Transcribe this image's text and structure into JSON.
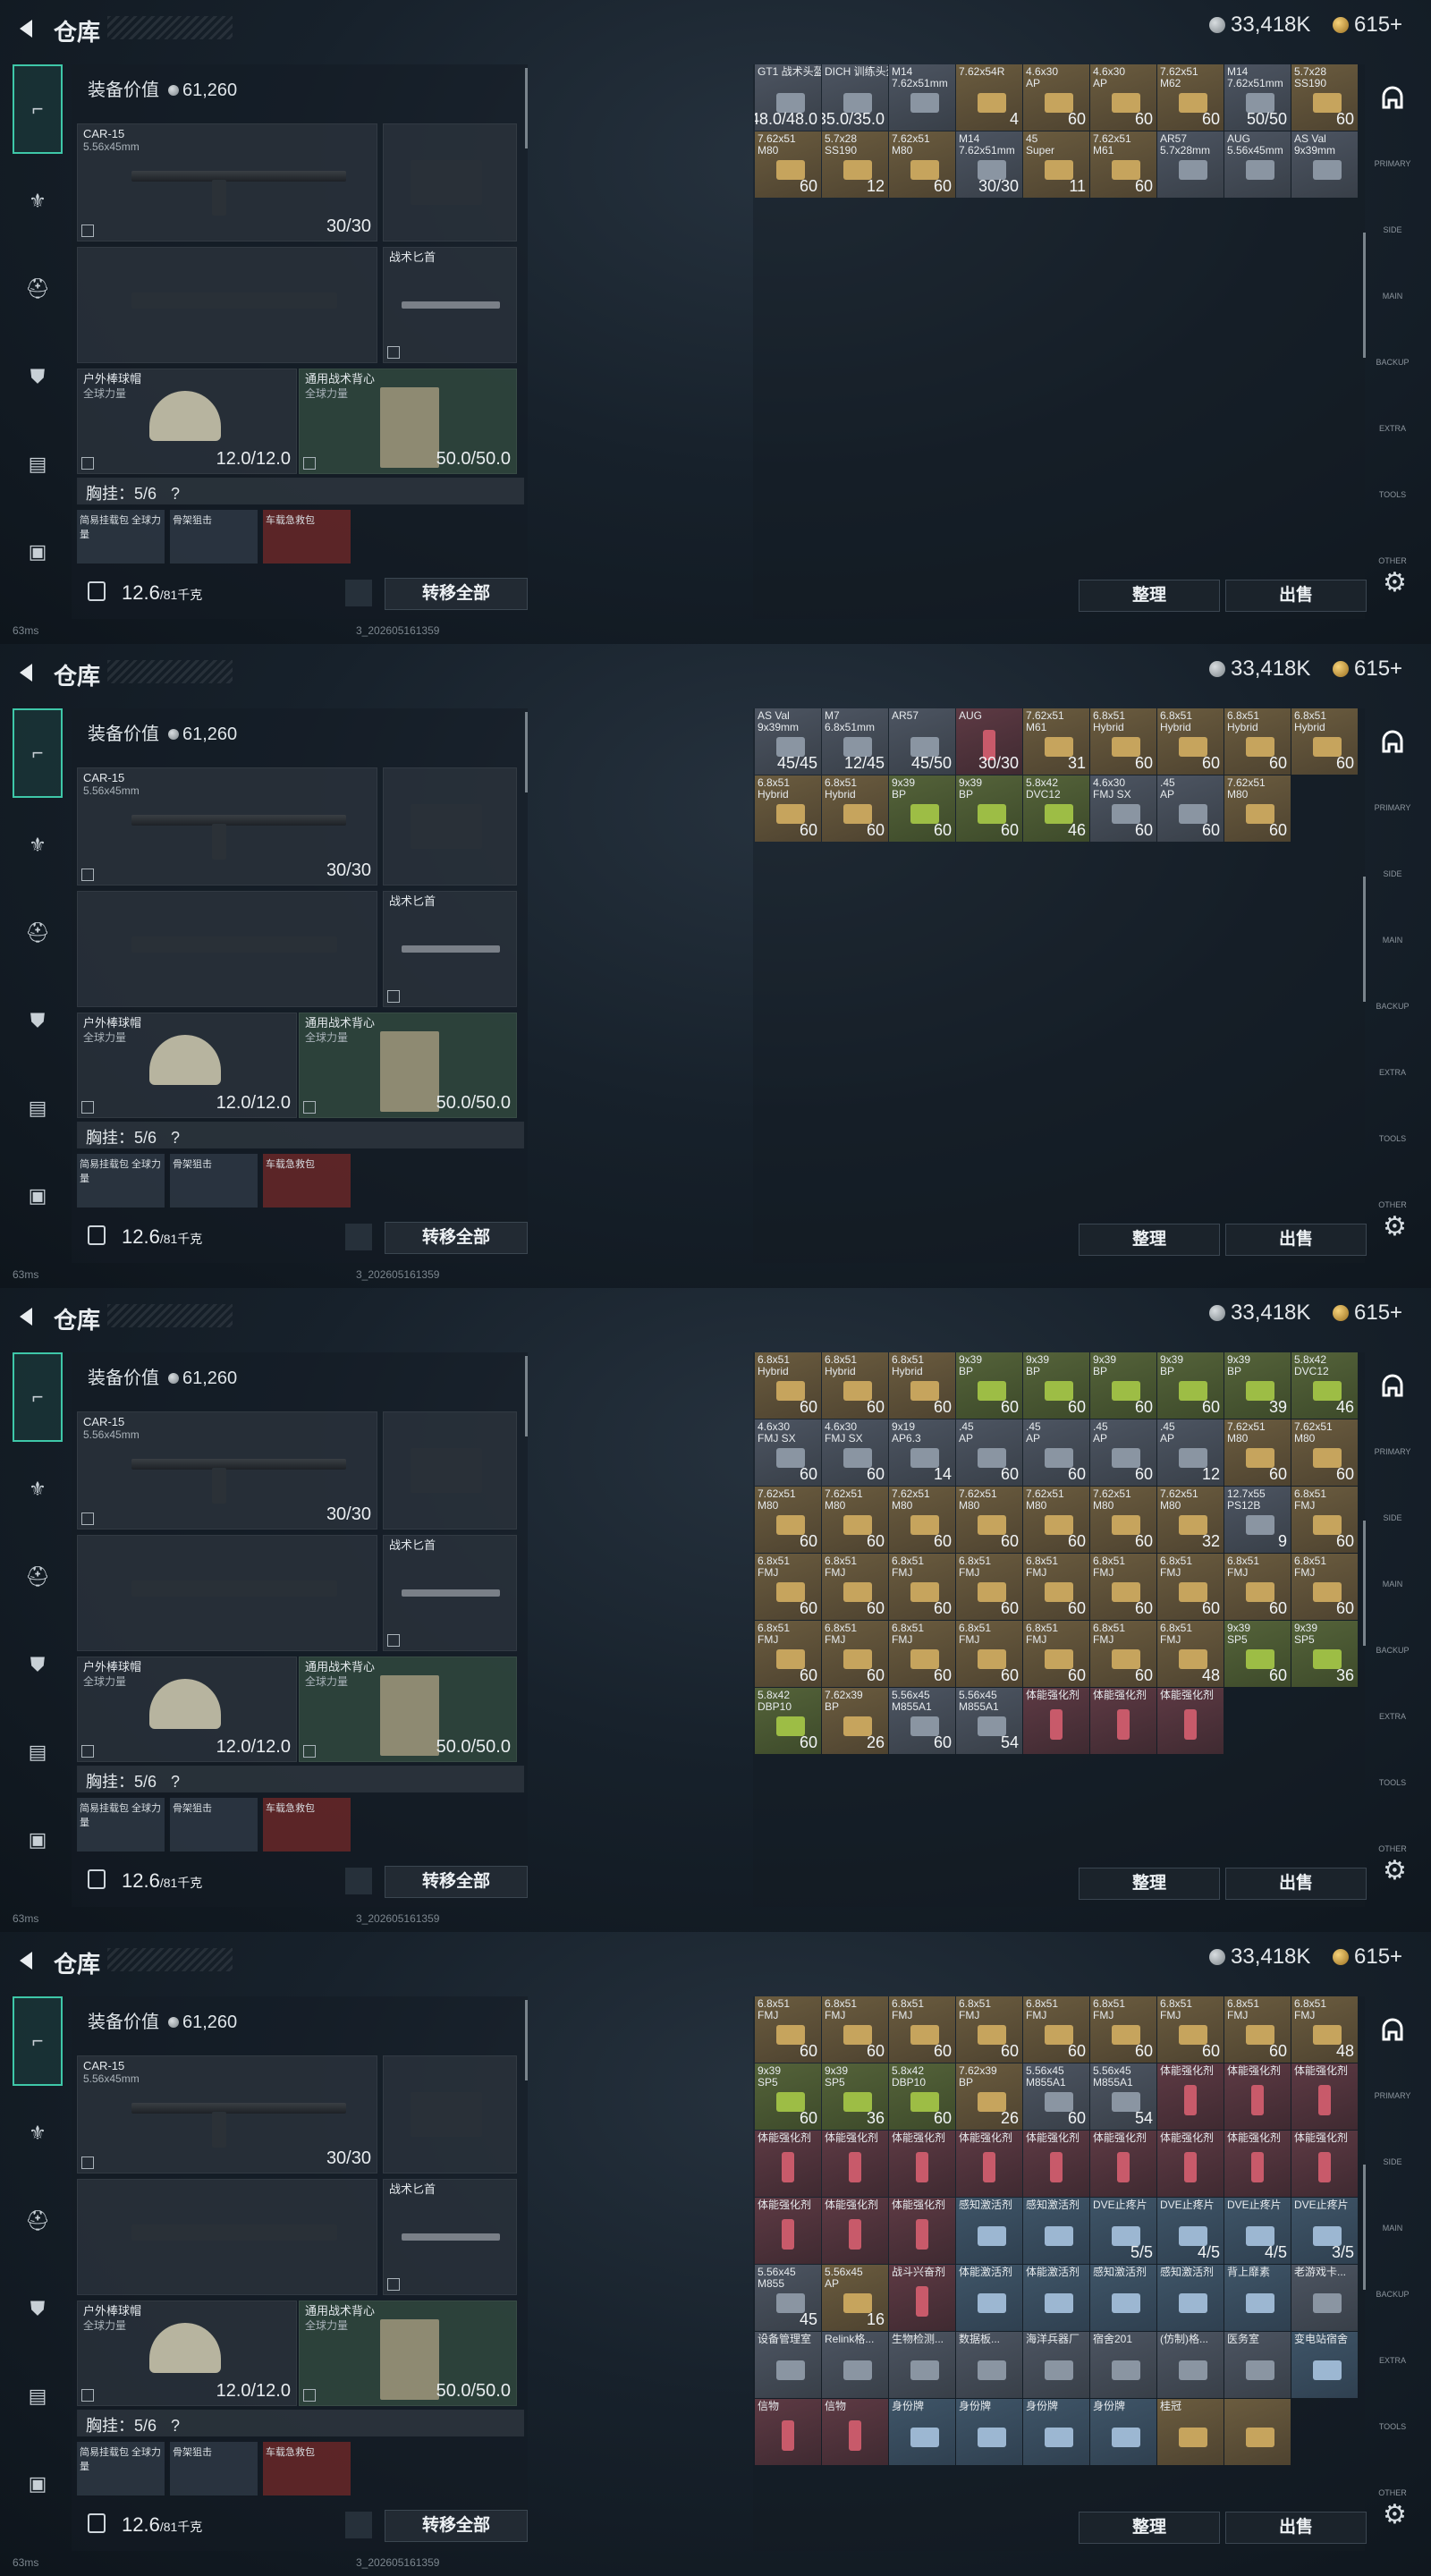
{
  "header": {
    "title": "仓库",
    "silver": "33,418K",
    "gold": "615+"
  },
  "loadout": {
    "value_label": "装备价值",
    "value": "61,260",
    "primary": {
      "name": "CAR-15",
      "caliber": "5.56x45mm",
      "count": "30/30"
    },
    "knife": {
      "name": "战术匕首"
    },
    "helmet": {
      "name": "户外棒球帽",
      "sub": "全球力量",
      "count": "12.0/12.0"
    },
    "armor": {
      "name": "通用战术背心",
      "sub": "全球力量",
      "count": "50.0/50.0"
    },
    "chest_label": "胸挂：5/6",
    "chest_help": "?",
    "mini_items": [
      "简易挂载包\n全球力量",
      "骨架狙击",
      "车载急救包"
    ],
    "weight": "12.6",
    "weight_max": "/81千克",
    "transfer_button": "转移全部"
  },
  "storage": {
    "sort_button": "整理",
    "sell_button": "出售"
  },
  "status": {
    "ping": "63ms",
    "build": "3_202605161359"
  },
  "frames": [
    {
      "cells": [
        {
          "n": "GT1 战术头盔",
          "q": "48.0/48.0",
          "c": "grey"
        },
        {
          "n": "DICH 训练头盔",
          "q": "35.0/35.0",
          "c": "grey"
        },
        {
          "n": "M14\n7.62x51mm",
          "q": "",
          "c": "grey"
        },
        {
          "n": "7.62x54R",
          "q": "4",
          "c": "tan"
        },
        {
          "n": "4.6x30\nAP",
          "q": "60",
          "c": "tan"
        },
        {
          "n": "4.6x30\nAP",
          "q": "60",
          "c": "tan"
        },
        {
          "n": "7.62x51\nM62",
          "q": "60",
          "c": "tan"
        },
        {
          "n": "M14\n7.62x51mm",
          "q": "50/50",
          "c": "grey"
        },
        {
          "n": "5.7x28\nSS190",
          "q": "60",
          "c": "tan"
        },
        {
          "n": "7.62x51\nM80",
          "q": "60",
          "c": "tan"
        },
        {
          "n": "5.7x28\nSS190",
          "q": "12",
          "c": "tan"
        },
        {
          "n": "7.62x51\nM80",
          "q": "60",
          "c": "tan"
        },
        {
          "n": "M14\n7.62x51mm",
          "q": "30/30",
          "c": "grey"
        },
        {
          "n": "45\nSuper",
          "q": "11",
          "c": "tan"
        },
        {
          "n": "7.62x51\nM61",
          "q": "60",
          "c": "tan"
        },
        {
          "n": "AR57\n5.7x28mm",
          "q": "",
          "c": "grey"
        },
        {
          "n": "AUG\n5.56x45mm",
          "q": "",
          "c": "grey"
        },
        {
          "n": "AS Val\n9x39mm",
          "q": "",
          "c": "grey"
        }
      ]
    },
    {
      "cells": [
        {
          "n": "AS Val\n9x39mm",
          "q": "45/45",
          "c": "grey"
        },
        {
          "n": "M7\n6.8x51mm",
          "q": "12/45",
          "c": "grey"
        },
        {
          "n": "AR57",
          "q": "45/50",
          "c": "grey"
        },
        {
          "n": "AUG",
          "q": "30/30",
          "c": "red"
        },
        {
          "n": "7.62x51\nM61",
          "q": "31",
          "c": "tan"
        },
        {
          "n": "6.8x51\nHybrid",
          "q": "60",
          "c": "tan"
        },
        {
          "n": "6.8x51\nHybrid",
          "q": "60",
          "c": "tan"
        },
        {
          "n": "6.8x51\nHybrid",
          "q": "60",
          "c": "tan"
        },
        {
          "n": "6.8x51\nHybrid",
          "q": "60",
          "c": "tan"
        },
        {
          "n": "6.8x51\nHybrid",
          "q": "60",
          "c": "tan"
        },
        {
          "n": "6.8x51\nHybrid",
          "q": "60",
          "c": "tan"
        },
        {
          "n": "9x39\nBP",
          "q": "60",
          "c": "green"
        },
        {
          "n": "9x39\nBP",
          "q": "60",
          "c": "green"
        },
        {
          "n": "5.8x42\nDVC12",
          "q": "46",
          "c": "green"
        },
        {
          "n": "4.6x30\nFMJ SX",
          "q": "60",
          "c": "grey"
        },
        {
          "n": ".45\nAP",
          "q": "60",
          "c": "grey"
        },
        {
          "n": "7.62x51\nM80",
          "q": "60",
          "c": "tan"
        }
      ]
    },
    {
      "cells": [
        {
          "n": "6.8x51\nHybrid",
          "q": "60",
          "c": "tan"
        },
        {
          "n": "6.8x51\nHybrid",
          "q": "60",
          "c": "tan"
        },
        {
          "n": "6.8x51\nHybrid",
          "q": "60",
          "c": "tan"
        },
        {
          "n": "9x39\nBP",
          "q": "60",
          "c": "green"
        },
        {
          "n": "9x39\nBP",
          "q": "60",
          "c": "green"
        },
        {
          "n": "9x39\nBP",
          "q": "60",
          "c": "green"
        },
        {
          "n": "9x39\nBP",
          "q": "60",
          "c": "green"
        },
        {
          "n": "9x39\nBP",
          "q": "39",
          "c": "green"
        },
        {
          "n": "5.8x42\nDVC12",
          "q": "46",
          "c": "green"
        },
        {
          "n": "4.6x30\nFMJ SX",
          "q": "60",
          "c": "grey"
        },
        {
          "n": "4.6x30\nFMJ SX",
          "q": "60",
          "c": "grey"
        },
        {
          "n": "9x19\nAP6.3",
          "q": "14",
          "c": "grey"
        },
        {
          "n": ".45\nAP",
          "q": "60",
          "c": "grey"
        },
        {
          "n": ".45\nAP",
          "q": "60",
          "c": "grey"
        },
        {
          "n": ".45\nAP",
          "q": "60",
          "c": "grey"
        },
        {
          "n": ".45\nAP",
          "q": "12",
          "c": "grey"
        },
        {
          "n": "7.62x51\nM80",
          "q": "60",
          "c": "tan"
        },
        {
          "n": "7.62x51\nM80",
          "q": "60",
          "c": "tan"
        },
        {
          "n": "7.62x51\nM80",
          "q": "60",
          "c": "tan"
        },
        {
          "n": "7.62x51\nM80",
          "q": "60",
          "c": "tan"
        },
        {
          "n": "7.62x51\nM80",
          "q": "60",
          "c": "tan"
        },
        {
          "n": "7.62x51\nM80",
          "q": "60",
          "c": "tan"
        },
        {
          "n": "7.62x51\nM80",
          "q": "60",
          "c": "tan"
        },
        {
          "n": "7.62x51\nM80",
          "q": "60",
          "c": "tan"
        },
        {
          "n": "7.62x51\nM80",
          "q": "32",
          "c": "tan"
        },
        {
          "n": "12.7x55\nPS12B",
          "q": "9",
          "c": "grey"
        },
        {
          "n": "6.8x51\nFMJ",
          "q": "60",
          "c": "tan"
        },
        {
          "n": "6.8x51\nFMJ",
          "q": "60",
          "c": "tan"
        },
        {
          "n": "6.8x51\nFMJ",
          "q": "60",
          "c": "tan"
        },
        {
          "n": "6.8x51\nFMJ",
          "q": "60",
          "c": "tan"
        },
        {
          "n": "6.8x51\nFMJ",
          "q": "60",
          "c": "tan"
        },
        {
          "n": "6.8x51\nFMJ",
          "q": "60",
          "c": "tan"
        },
        {
          "n": "6.8x51\nFMJ",
          "q": "60",
          "c": "tan"
        },
        {
          "n": "6.8x51\nFMJ",
          "q": "60",
          "c": "tan"
        },
        {
          "n": "6.8x51\nFMJ",
          "q": "60",
          "c": "tan"
        },
        {
          "n": "6.8x51\nFMJ",
          "q": "60",
          "c": "tan"
        },
        {
          "n": "6.8x51\nFMJ",
          "q": "60",
          "c": "tan"
        },
        {
          "n": "6.8x51\nFMJ",
          "q": "60",
          "c": "tan"
        },
        {
          "n": "6.8x51\nFMJ",
          "q": "60",
          "c": "tan"
        },
        {
          "n": "6.8x51\nFMJ",
          "q": "60",
          "c": "tan"
        },
        {
          "n": "6.8x51\nFMJ",
          "q": "60",
          "c": "tan"
        },
        {
          "n": "6.8x51\nFMJ",
          "q": "60",
          "c": "tan"
        },
        {
          "n": "6.8x51\nFMJ",
          "q": "48",
          "c": "tan"
        },
        {
          "n": "9x39\nSP5",
          "q": "60",
          "c": "green"
        },
        {
          "n": "9x39\nSP5",
          "q": "36",
          "c": "green"
        },
        {
          "n": "5.8x42\nDBP10",
          "q": "60",
          "c": "green"
        },
        {
          "n": "7.62x39\nBP",
          "q": "26",
          "c": "tan"
        },
        {
          "n": "5.56x45\nM855A1",
          "q": "60",
          "c": "grey"
        },
        {
          "n": "5.56x45\nM855A1",
          "q": "54",
          "c": "grey"
        },
        {
          "n": "体能强化剂",
          "q": "",
          "c": "red"
        },
        {
          "n": "体能强化剂",
          "q": "",
          "c": "red"
        },
        {
          "n": "体能强化剂",
          "q": "",
          "c": "red"
        }
      ]
    },
    {
      "cells": [
        {
          "n": "6.8x51\nFMJ",
          "q": "60",
          "c": "tan"
        },
        {
          "n": "6.8x51\nFMJ",
          "q": "60",
          "c": "tan"
        },
        {
          "n": "6.8x51\nFMJ",
          "q": "60",
          "c": "tan"
        },
        {
          "n": "6.8x51\nFMJ",
          "q": "60",
          "c": "tan"
        },
        {
          "n": "6.8x51\nFMJ",
          "q": "60",
          "c": "tan"
        },
        {
          "n": "6.8x51\nFMJ",
          "q": "60",
          "c": "tan"
        },
        {
          "n": "6.8x51\nFMJ",
          "q": "60",
          "c": "tan"
        },
        {
          "n": "6.8x51\nFMJ",
          "q": "60",
          "c": "tan"
        },
        {
          "n": "6.8x51\nFMJ",
          "q": "48",
          "c": "tan"
        },
        {
          "n": "9x39\nSP5",
          "q": "60",
          "c": "green"
        },
        {
          "n": "9x39\nSP5",
          "q": "36",
          "c": "green"
        },
        {
          "n": "5.8x42\nDBP10",
          "q": "60",
          "c": "green"
        },
        {
          "n": "7.62x39\nBP",
          "q": "26",
          "c": "tan"
        },
        {
          "n": "5.56x45\nM855A1",
          "q": "60",
          "c": "grey"
        },
        {
          "n": "5.56x45\nM855A1",
          "q": "54",
          "c": "grey"
        },
        {
          "n": "体能强化剂",
          "q": "",
          "c": "red"
        },
        {
          "n": "体能强化剂",
          "q": "",
          "c": "red"
        },
        {
          "n": "体能强化剂",
          "q": "",
          "c": "red"
        },
        {
          "n": "体能强化剂",
          "q": "",
          "c": "red"
        },
        {
          "n": "体能强化剂",
          "q": "",
          "c": "red"
        },
        {
          "n": "体能强化剂",
          "q": "",
          "c": "red"
        },
        {
          "n": "体能强化剂",
          "q": "",
          "c": "red"
        },
        {
          "n": "体能强化剂",
          "q": "",
          "c": "red"
        },
        {
          "n": "体能强化剂",
          "q": "",
          "c": "red"
        },
        {
          "n": "体能强化剂",
          "q": "",
          "c": "red"
        },
        {
          "n": "体能强化剂",
          "q": "",
          "c": "red"
        },
        {
          "n": "体能强化剂",
          "q": "",
          "c": "red"
        },
        {
          "n": "体能强化剂",
          "q": "",
          "c": "red"
        },
        {
          "n": "体能强化剂",
          "q": "",
          "c": "red"
        },
        {
          "n": "体能强化剂",
          "q": "",
          "c": "red"
        },
        {
          "n": "感知激活剂",
          "q": "",
          "c": "blue"
        },
        {
          "n": "感知激活剂",
          "q": "",
          "c": "blue"
        },
        {
          "n": "DVE止疼片",
          "q": "5/5",
          "c": "blue"
        },
        {
          "n": "DVE止疼片",
          "q": "4/5",
          "c": "blue"
        },
        {
          "n": "DVE止疼片",
          "q": "4/5",
          "c": "blue"
        },
        {
          "n": "DVE止疼片",
          "q": "3/5",
          "c": "blue"
        },
        {
          "n": "5.56x45\nM855",
          "q": "45",
          "c": "grey"
        },
        {
          "n": "5.56x45\nAP",
          "q": "16",
          "c": "tan"
        },
        {
          "n": "战斗兴奋剂",
          "q": "",
          "c": "red"
        },
        {
          "n": "体能激活剂",
          "q": "",
          "c": "blue"
        },
        {
          "n": "体能激活剂",
          "q": "",
          "c": "blue"
        },
        {
          "n": "感知激活剂",
          "q": "",
          "c": "blue"
        },
        {
          "n": "感知激活剂",
          "q": "",
          "c": "blue"
        },
        {
          "n": "背上靡素",
          "q": "",
          "c": "blue"
        },
        {
          "n": "老游戏卡...",
          "q": "",
          "c": "grey"
        },
        {
          "n": "设备管理室",
          "q": "",
          "c": "grey"
        },
        {
          "n": "Relink格...",
          "q": "",
          "c": "grey"
        },
        {
          "n": "生物检测...",
          "q": "",
          "c": "grey"
        },
        {
          "n": "数据板...",
          "q": "",
          "c": "grey"
        },
        {
          "n": "海洋兵器厂",
          "q": "",
          "c": "grey"
        },
        {
          "n": "宿舍201",
          "q": "",
          "c": "grey"
        },
        {
          "n": "(仿制)格...",
          "q": "",
          "c": "grey"
        },
        {
          "n": "医务室",
          "q": "",
          "c": "grey"
        },
        {
          "n": "变电站宿舍",
          "q": "",
          "c": "blue"
        },
        {
          "n": "信物",
          "q": "",
          "c": "red"
        },
        {
          "n": "信物",
          "q": "",
          "c": "red"
        },
        {
          "n": "身份牌",
          "q": "",
          "c": "blue"
        },
        {
          "n": "身份牌",
          "q": "",
          "c": "blue"
        },
        {
          "n": "身份牌",
          "q": "",
          "c": "blue"
        },
        {
          "n": "身份牌",
          "q": "",
          "c": "blue"
        },
        {
          "n": "桂冠",
          "q": "",
          "c": "tan"
        },
        {
          "n": "",
          "q": "",
          "c": "tan"
        }
      ]
    }
  ],
  "right_nav": [
    "PRIMARY",
    "SIDE",
    "MAIN",
    "BACKUP",
    "EXTRA",
    "TOOLS",
    "OTHER"
  ]
}
